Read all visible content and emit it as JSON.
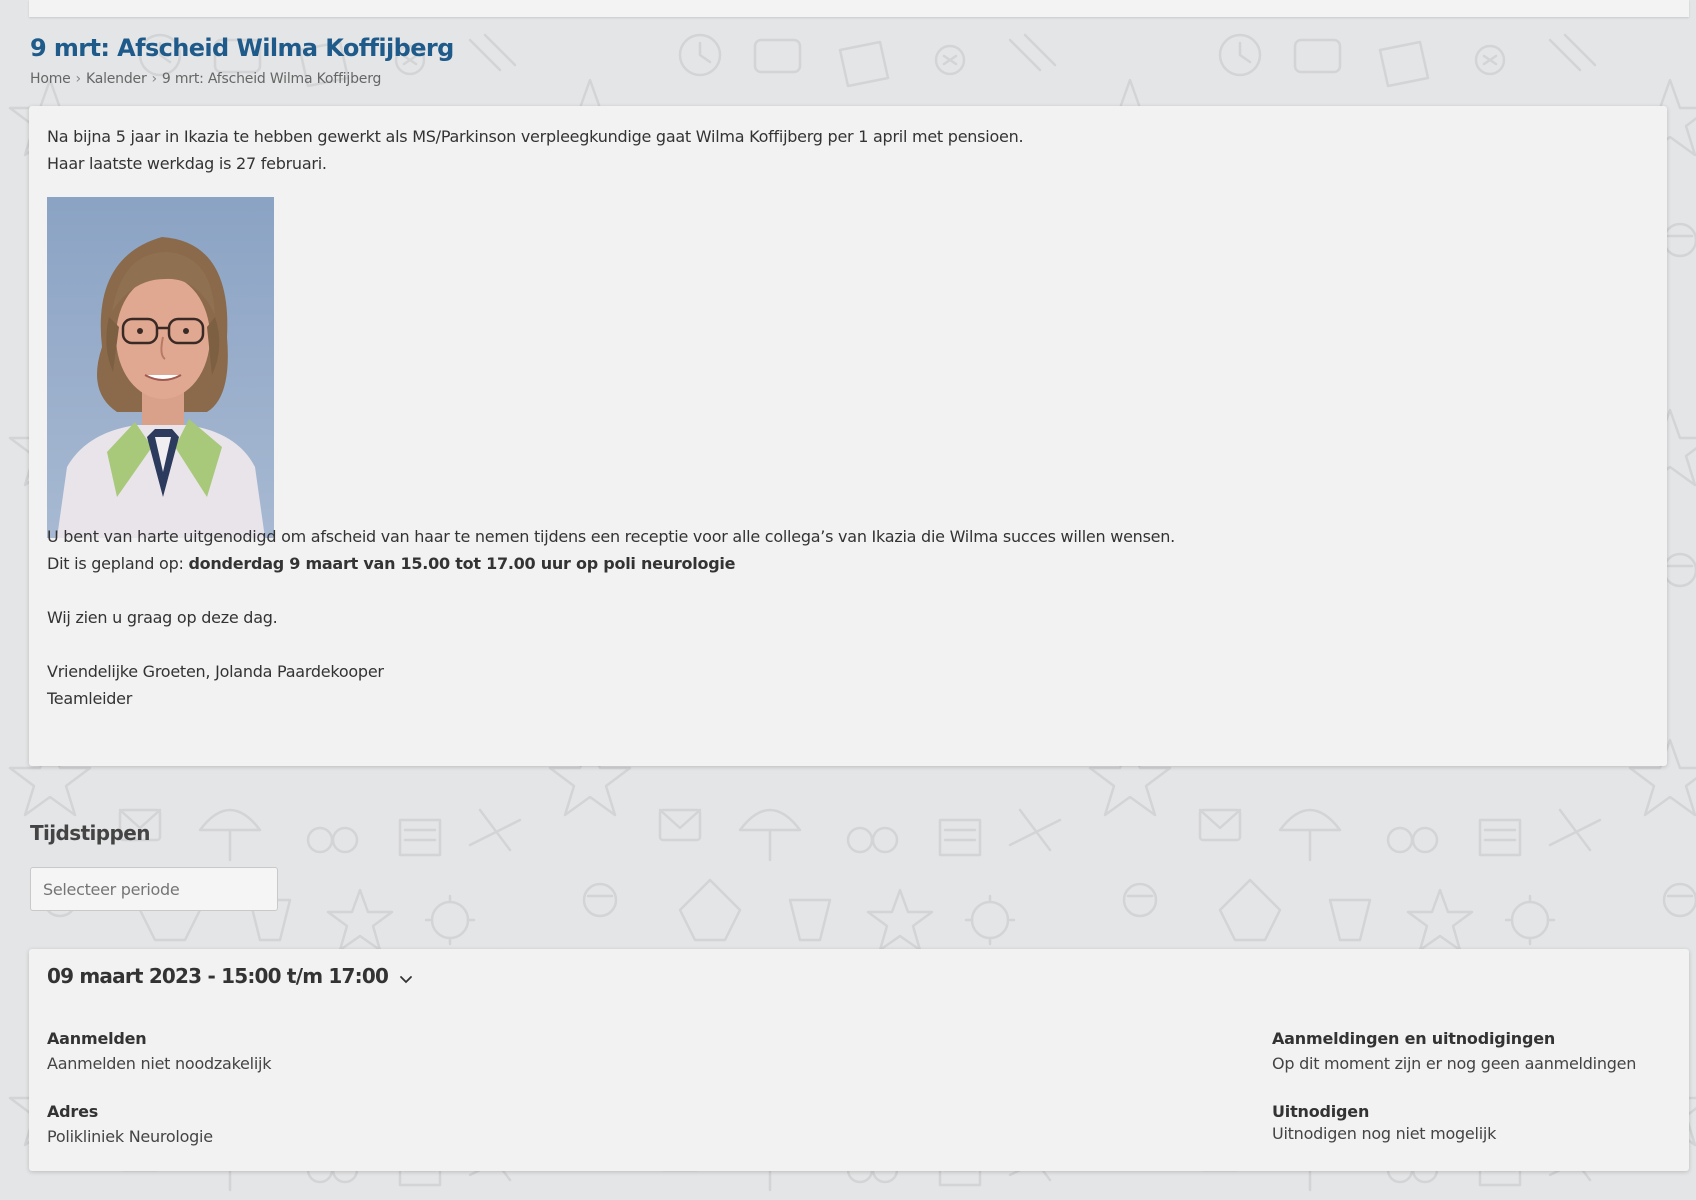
{
  "page": {
    "title": "9 mrt: Afscheid Wilma Koffijberg",
    "breadcrumb": [
      "Home",
      "Kalender",
      "9 mrt: Afscheid Wilma Koffijberg"
    ]
  },
  "article": {
    "intro_line1": "Na bijna 5 jaar in Ikazia te hebben gewerkt als MS/Parkinson verpleegkundige gaat Wilma Koffijberg per 1 april met pensioen.",
    "intro_line2": "Haar laatste werkdag is 27 februari.",
    "invite_line": "U bent van harte uitgenodigd om afscheid van haar te nemen tijdens een receptie voor alle collega’s van Ikazia die Wilma succes willen wensen.",
    "planned_prefix": "Dit is gepland op: ",
    "planned_bold": "donderdag 9 maart van 15.00 tot 17.00 uur op poli neurologie",
    "closing": "Wij zien u graag op deze dag.",
    "greeting": "Vriendelijke Groeten, Jolanda Paardekooper",
    "role": "Teamleider"
  },
  "timeslots": {
    "heading": "Tijdstippen",
    "period_placeholder": "Selecteer periode",
    "entry": {
      "title": "09 maart 2023 - 15:00 t/m 17:00",
      "register_label": "Aanmelden",
      "register_value": "Aanmelden niet noodzakelijk",
      "address_label": "Adres",
      "address_value": "Polikliniek Neurologie",
      "signups_label": "Aanmeldingen en uitnodigingen",
      "signups_value": "Op dit moment zijn er nog geen aanmeldingen",
      "invite_label": "Uitnodigen",
      "invite_value": "Uitnodigen nog niet mogelijk"
    }
  },
  "colors": {
    "title_blue": "#1e5a8a",
    "background": "#e4e5e6",
    "card": "#f2f2f2"
  }
}
